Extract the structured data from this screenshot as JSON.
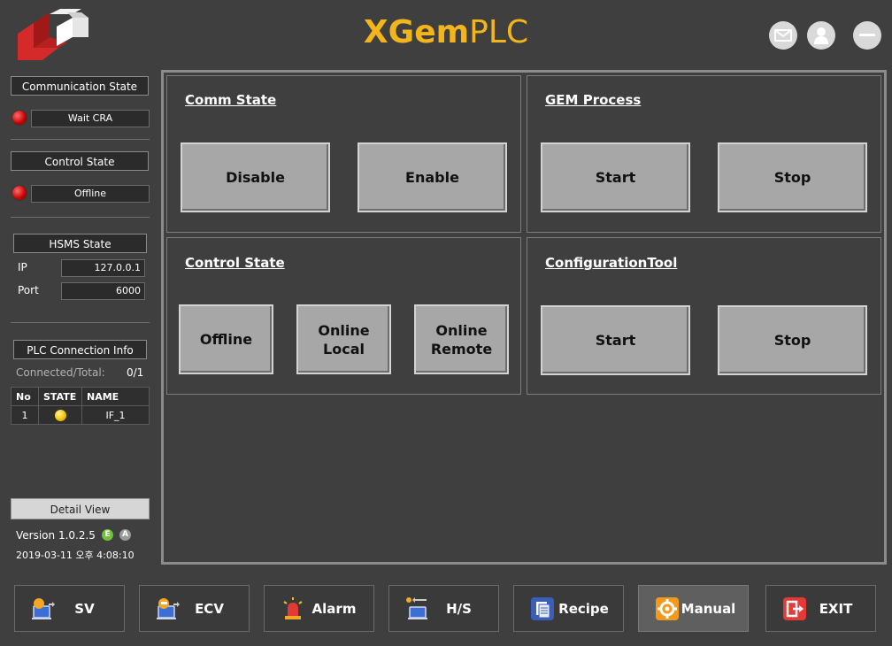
{
  "header": {
    "title_part1": "XGem",
    "title_part2": "PLC"
  },
  "sidebar": {
    "communication": {
      "title": "Communication State",
      "value": "Wait CRA"
    },
    "control": {
      "title": "Control State",
      "value": "Offline"
    },
    "hsms": {
      "title": "HSMS State",
      "ip_label": "IP",
      "ip_value": "127.0.0.1",
      "port_label": "Port",
      "port_value": "6000"
    },
    "plc": {
      "title": "PLC Connection Info",
      "connected_label": "Connected/Total:",
      "connected_value": "0/1",
      "columns": [
        "No",
        "STATE",
        "NAME"
      ],
      "rows": [
        {
          "no": "1",
          "name": "IF_1"
        }
      ]
    },
    "detail_view": "Detail View",
    "version": "Version 1.0.2.5",
    "badge_e": "E",
    "badge_a": "A",
    "datetime": "2019-03-11 오후 4:08:10"
  },
  "panels": {
    "comm": {
      "title": "Comm State",
      "btn1": "Disable",
      "btn2": "Enable"
    },
    "gem": {
      "title": "GEM Process",
      "btn1": "Start",
      "btn2": "Stop"
    },
    "control": {
      "title": "Control State",
      "btn1": "Offline",
      "btn2_l1": "Online",
      "btn2_l2": "Local",
      "btn3_l1": "Online",
      "btn3_l2": "Remote"
    },
    "config": {
      "title": "ConfigurationTool",
      "btn1": "Start",
      "btn2": "Stop"
    }
  },
  "nav": {
    "sv": "SV",
    "ecv": "ECV",
    "alarm": "Alarm",
    "hs": "H/S",
    "recipe": "Recipe",
    "manual": "Manual",
    "exit": "EXIT"
  },
  "colors": {
    "accent": "#f2b51c",
    "led_red": "#d40000",
    "led_yellow": "#f5c400",
    "badge_e": "#6fc23a",
    "badge_a": "#9a9a9a"
  }
}
